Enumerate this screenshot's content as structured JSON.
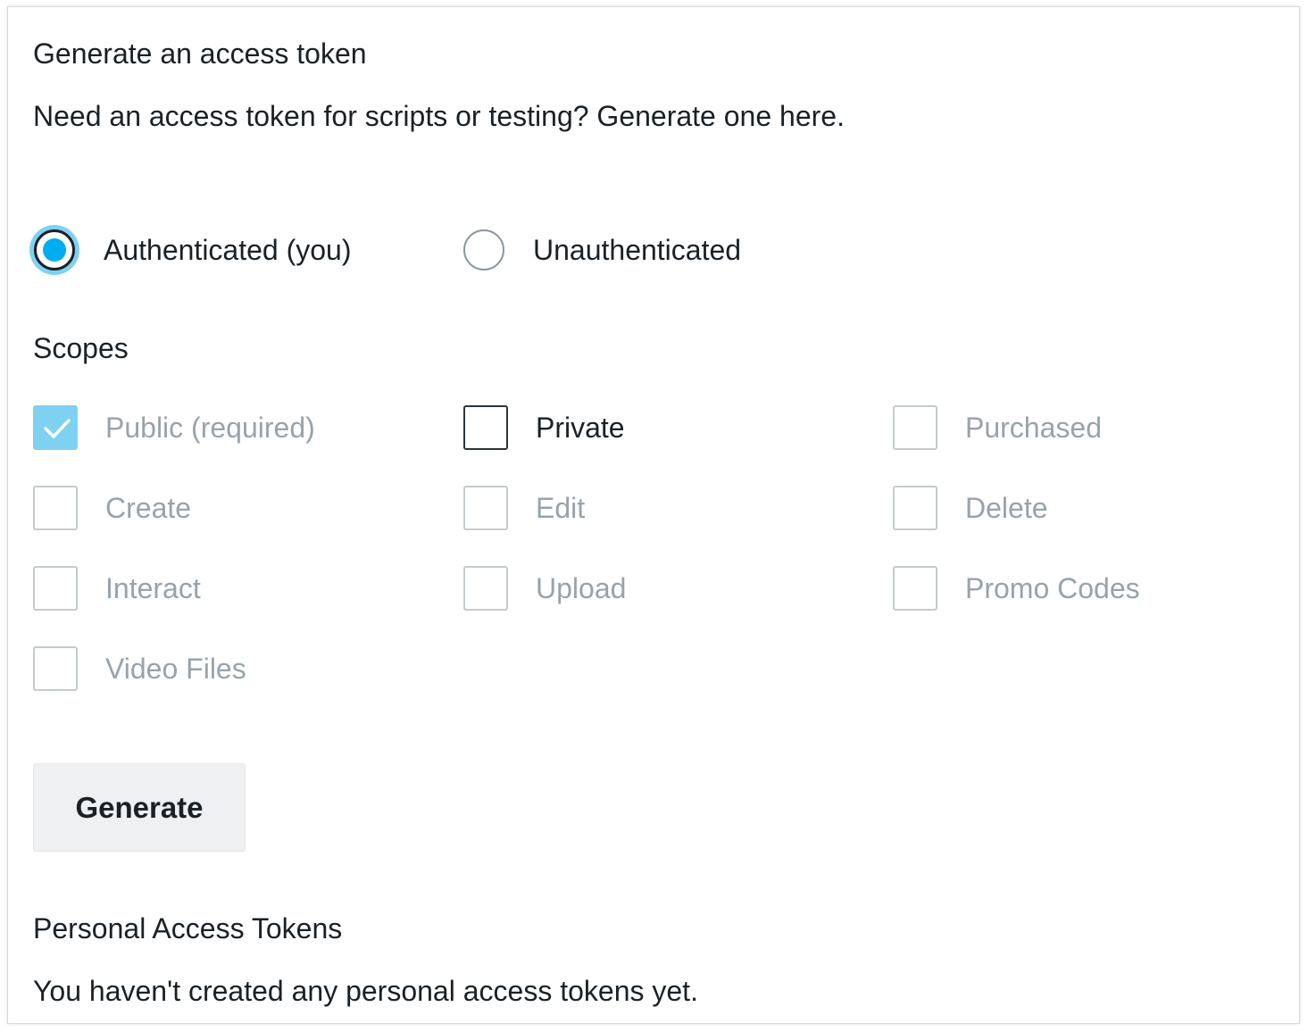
{
  "generate_section": {
    "title": "Generate an access token",
    "description": "Need an access token for scripts or testing? Generate one here.",
    "auth_options": [
      {
        "label": "Authenticated (you)",
        "selected": true
      },
      {
        "label": "Unauthenticated",
        "selected": false
      }
    ],
    "scopes_title": "Scopes",
    "scopes": [
      {
        "label": "Public (required)",
        "checked": true,
        "enabled": false
      },
      {
        "label": "Private",
        "checked": false,
        "enabled": true
      },
      {
        "label": "Purchased",
        "checked": false,
        "enabled": false
      },
      {
        "label": "Create",
        "checked": false,
        "enabled": false
      },
      {
        "label": "Edit",
        "checked": false,
        "enabled": false
      },
      {
        "label": "Delete",
        "checked": false,
        "enabled": false
      },
      {
        "label": "Interact",
        "checked": false,
        "enabled": false
      },
      {
        "label": "Upload",
        "checked": false,
        "enabled": false
      },
      {
        "label": "Promo Codes",
        "checked": false,
        "enabled": false
      },
      {
        "label": "Video Files",
        "checked": false,
        "enabled": false
      }
    ],
    "generate_button": "Generate"
  },
  "tokens_section": {
    "title": "Personal Access Tokens",
    "empty_message": "You haven't created any personal access tokens yet."
  },
  "colors": {
    "accent": "#00adef",
    "focus_ring": "#7fd1f1",
    "text": "#1a2126",
    "muted_text": "#97a3ab",
    "button_bg": "#eef0f1"
  },
  "icons": {
    "checkmark": "check-icon"
  }
}
